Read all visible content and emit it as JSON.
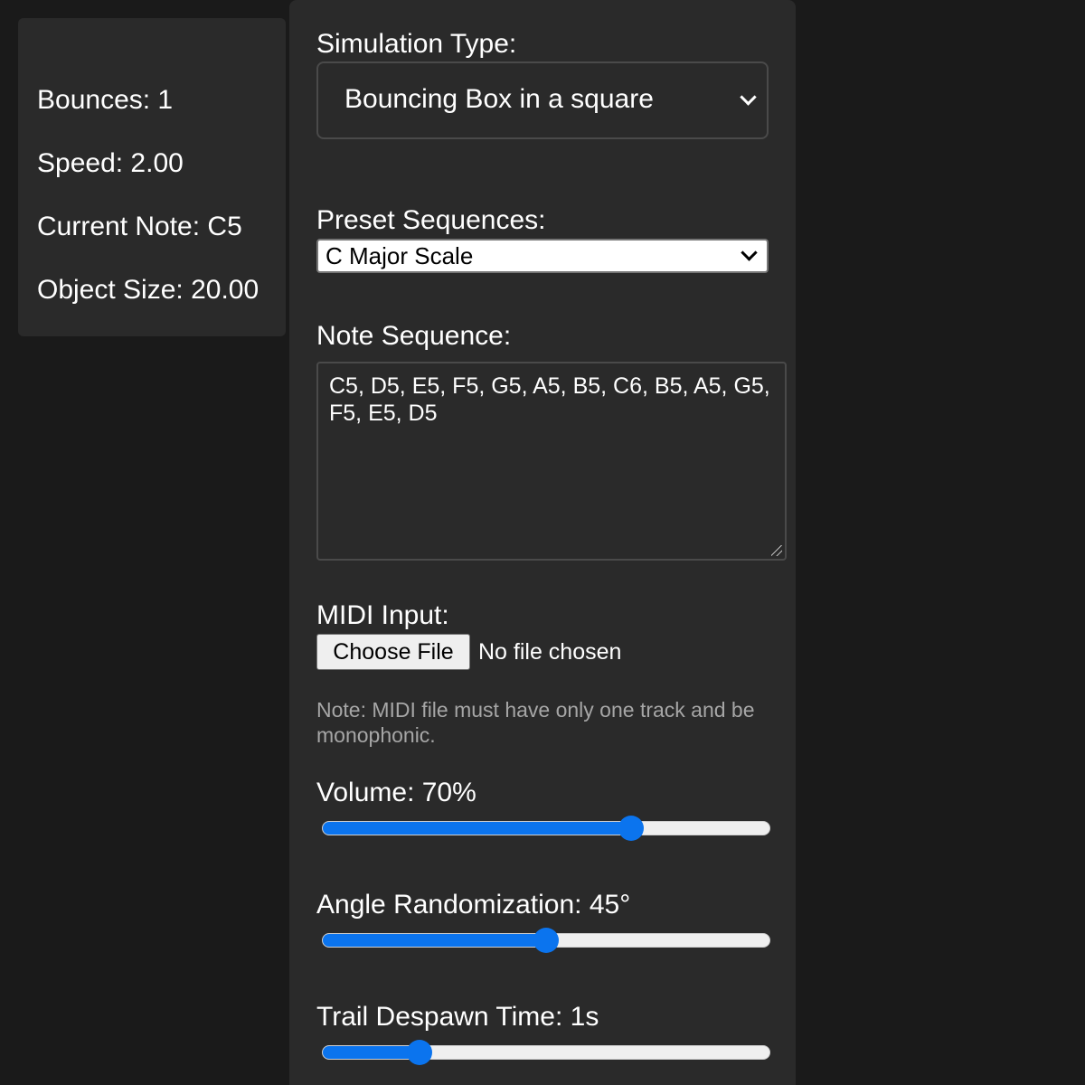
{
  "stats": {
    "bounces": "Bounces: 1",
    "speed": "Speed: 2.00",
    "current_note": "Current Note: C5",
    "object_size": "Object Size: 20.00"
  },
  "controls": {
    "simulation_type": {
      "label": "Simulation Type:",
      "selected": "Bouncing Box in a square"
    },
    "preset_sequences": {
      "label": "Preset Sequences:",
      "selected": "C Major Scale"
    },
    "note_sequence": {
      "label": "Note Sequence:",
      "value": "C5, D5, E5, F5, G5, A5, B5, C6, B5, A5, G5, F5, E5, D5"
    },
    "midi_input": {
      "label": "MIDI Input:",
      "button_label": "Choose File",
      "status": "No file chosen",
      "note": "Note: MIDI file must have only one track and be monophonic."
    },
    "volume": {
      "label": "Volume: 70%",
      "value": 0.7
    },
    "angle_randomization": {
      "label": "Angle Randomization: 45°",
      "value": 0.5
    },
    "trail_despawn_time": {
      "label": "Trail Despawn Time: 1s",
      "value": 0.2
    }
  },
  "colors": {
    "background": "#1a1a1a",
    "panel": "#2a2a2a",
    "accent": "#0b74ee",
    "muted_text": "#a6a6a6"
  },
  "icons": {
    "select_arrow": "chevron-down-icon",
    "textarea_resize": "resize-grip-icon"
  }
}
